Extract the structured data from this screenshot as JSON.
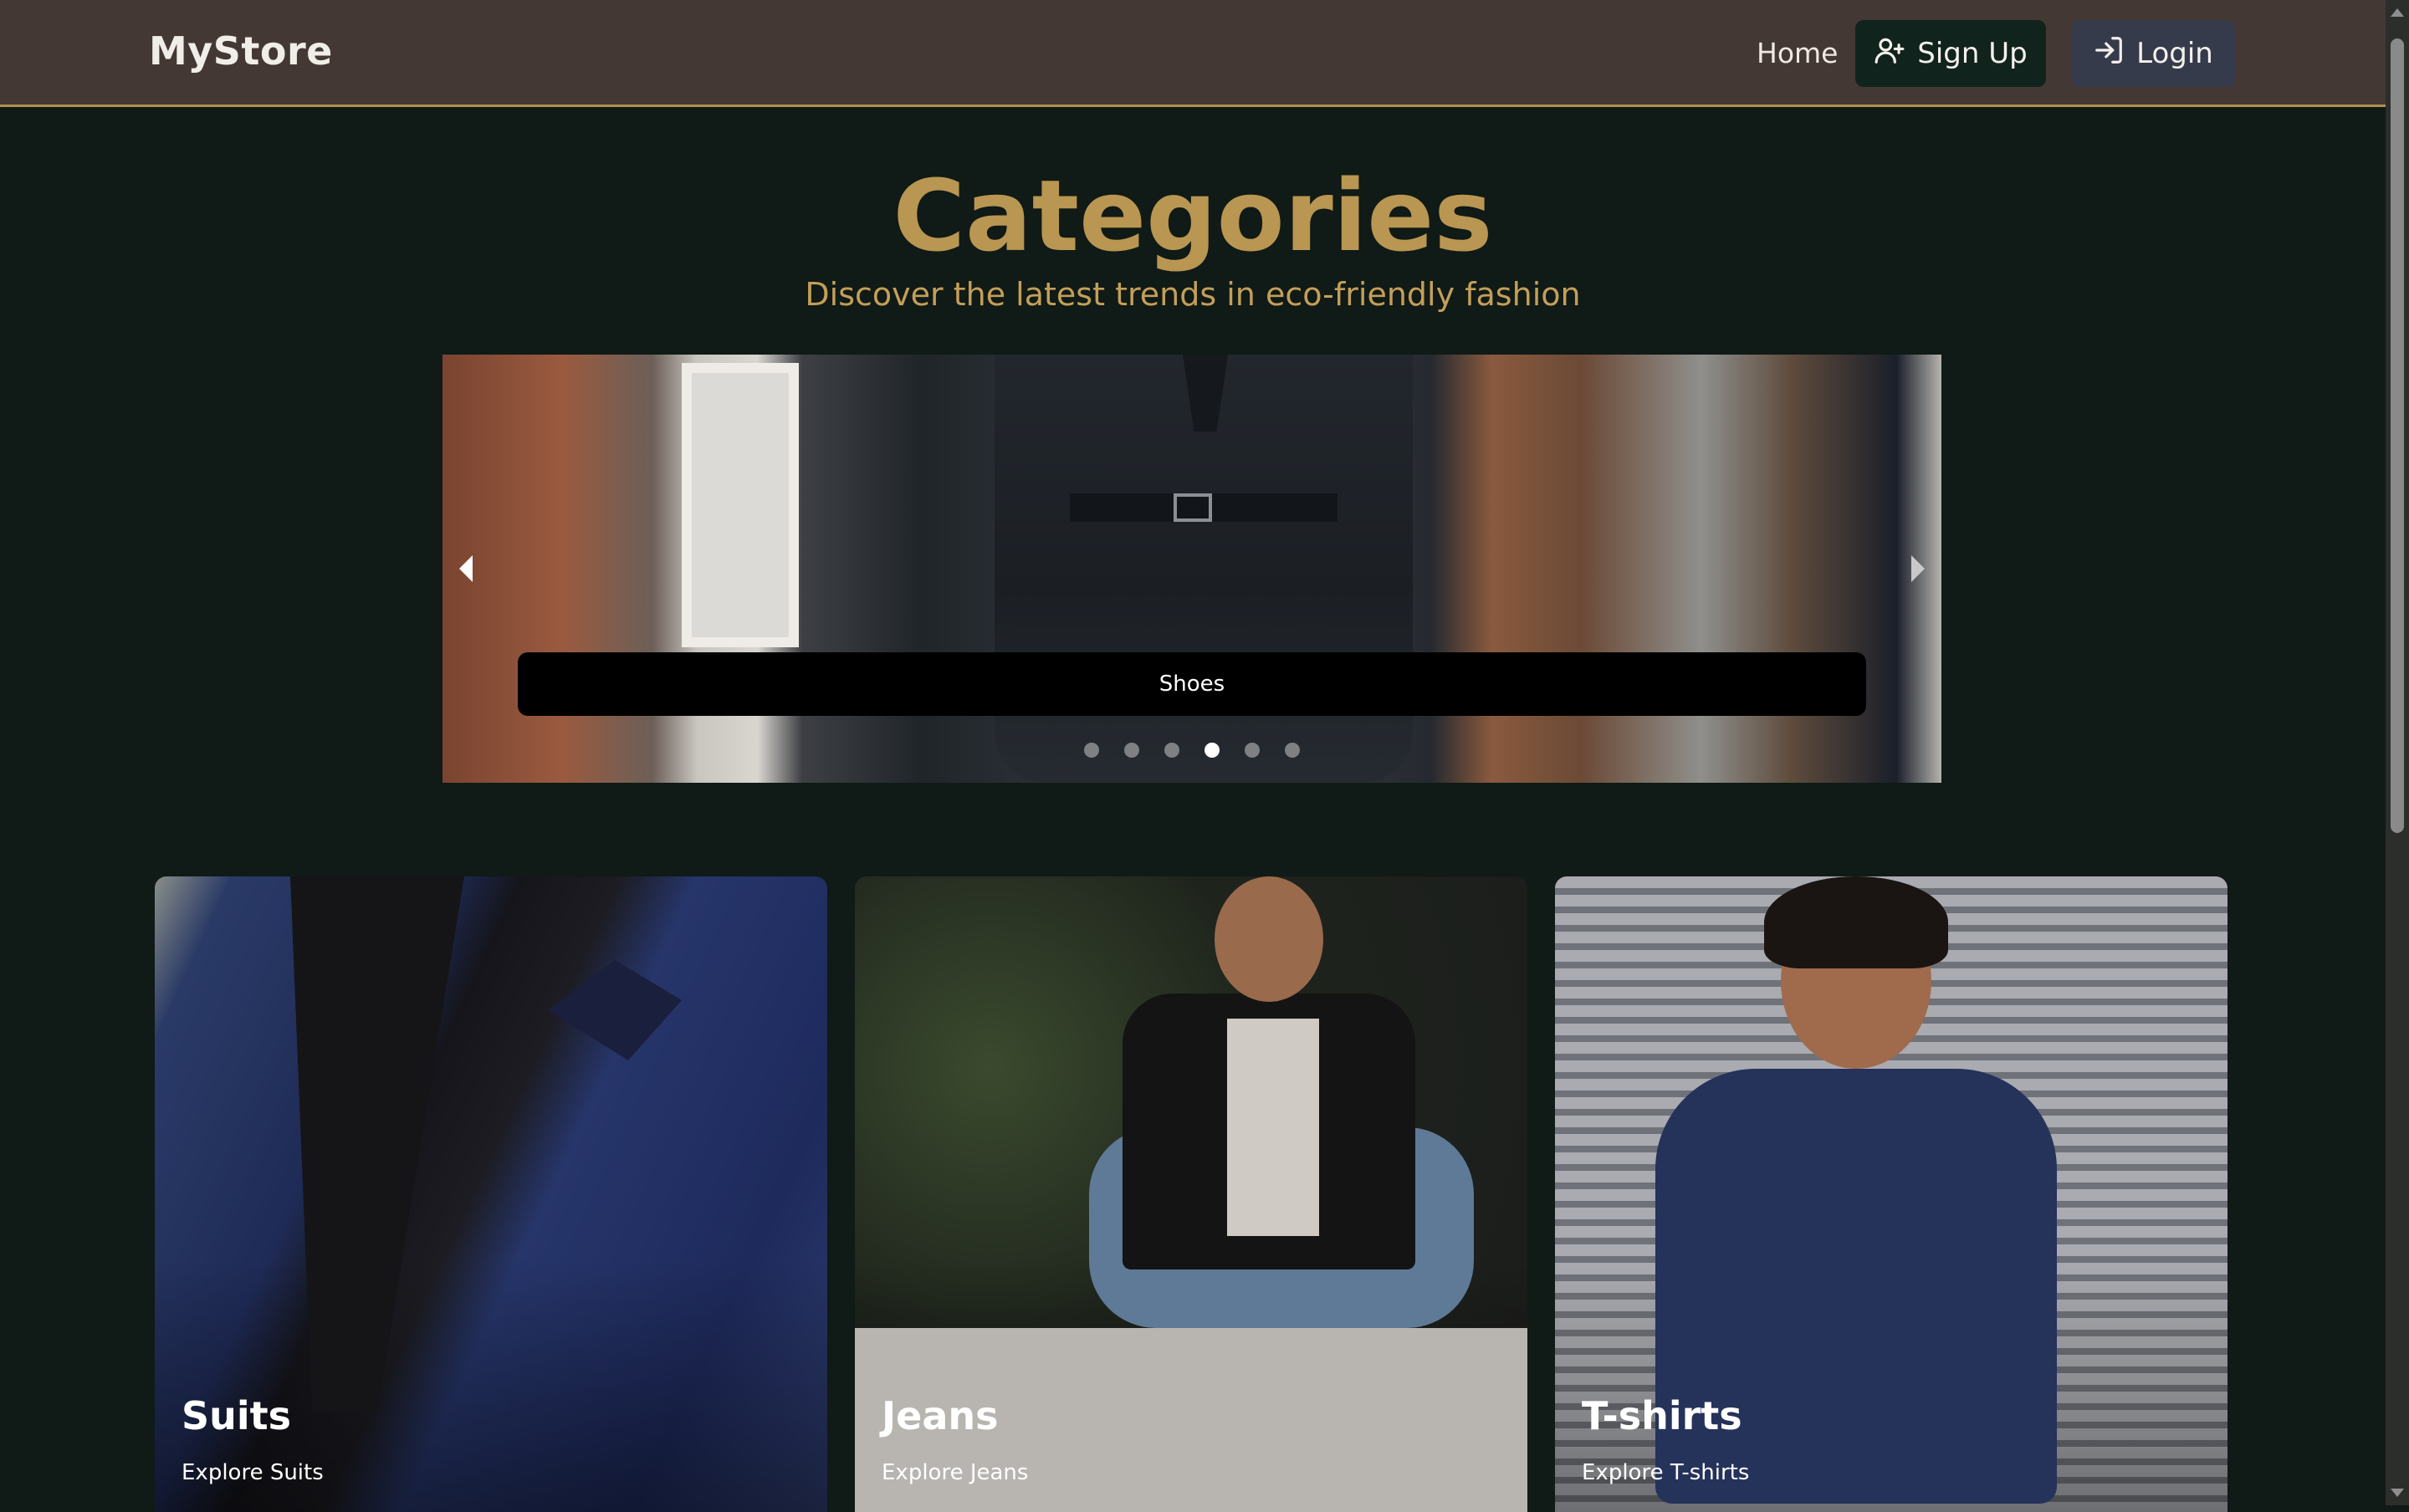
{
  "navbar": {
    "brand": "MyStore",
    "home_label": "Home",
    "signup_label": "Sign Up",
    "login_label": "Login"
  },
  "header": {
    "title": "Categories",
    "subtitle": "Discover the latest trends in eco-friendly fashion"
  },
  "carousel": {
    "caption": "Shoes",
    "slide_count": 6,
    "active_slide_index": 3
  },
  "categories": [
    {
      "title": "Suits",
      "subtitle": "Explore Suits"
    },
    {
      "title": "Jeans",
      "subtitle": "Explore Jeans"
    },
    {
      "title": "T-shirts",
      "subtitle": "Explore T-shirts"
    }
  ],
  "colors": {
    "page_background": "#101a16",
    "navbar_background": "#433834",
    "navbar_border": "#b08f4f",
    "accent_gold": "#b99651",
    "signup_button": "#11231d",
    "login_button": "#363b4c"
  },
  "icons": {
    "signup": "user-plus-icon",
    "login": "sign-in-icon",
    "carousel_prev": "chevron-left-icon",
    "carousel_next": "chevron-right-icon"
  }
}
